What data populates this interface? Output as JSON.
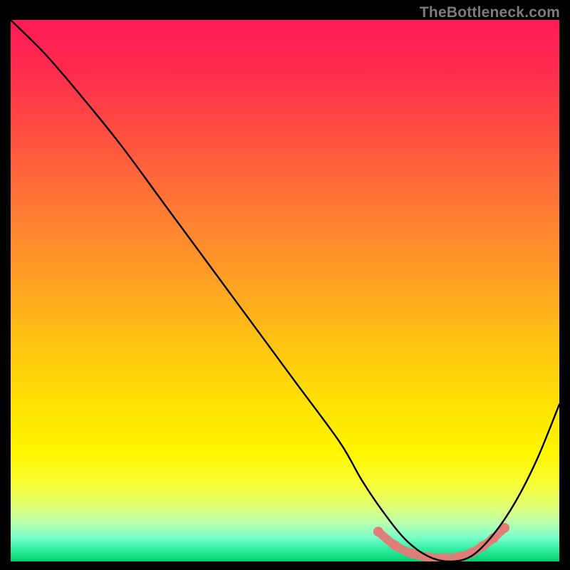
{
  "watermark": {
    "text": "TheBottleneck.com"
  },
  "chart_data": {
    "type": "line",
    "title": "",
    "xlabel": "",
    "ylabel": "",
    "xlim": [
      0,
      100
    ],
    "ylim": [
      0,
      100
    ],
    "grid": false,
    "legend": false,
    "series": [
      {
        "name": "main-curve",
        "x": [
          0,
          6,
          12,
          20,
          28,
          36,
          44,
          52,
          60,
          64,
          68,
          72,
          76,
          80,
          84,
          88,
          92,
          96,
          100
        ],
        "y": [
          100,
          94,
          87,
          77,
          66,
          55,
          44,
          33,
          22,
          15,
          9,
          4,
          1,
          0,
          1,
          5,
          11,
          19,
          29
        ]
      },
      {
        "name": "highlight-band",
        "x": [
          67,
          70,
          73,
          76,
          79,
          82,
          84,
          86,
          88,
          90
        ],
        "y": [
          5.5,
          3.0,
          1.5,
          0.8,
          0.6,
          0.9,
          1.6,
          2.8,
          4.3,
          6.2
        ]
      }
    ],
    "background_gradient_stops": [
      {
        "offset": 0.0,
        "color": "#ff1a55"
      },
      {
        "offset": 0.1,
        "color": "#ff2d4d"
      },
      {
        "offset": 0.22,
        "color": "#ff5240"
      },
      {
        "offset": 0.35,
        "color": "#ff7a34"
      },
      {
        "offset": 0.48,
        "color": "#ffa024"
      },
      {
        "offset": 0.6,
        "color": "#ffc512"
      },
      {
        "offset": 0.72,
        "color": "#ffe402"
      },
      {
        "offset": 0.8,
        "color": "#fff700"
      },
      {
        "offset": 0.86,
        "color": "#f6ff3a"
      },
      {
        "offset": 0.9,
        "color": "#e0ff78"
      },
      {
        "offset": 0.93,
        "color": "#b7ffb0"
      },
      {
        "offset": 0.955,
        "color": "#7affc8"
      },
      {
        "offset": 0.975,
        "color": "#38f0a6"
      },
      {
        "offset": 1.0,
        "color": "#00d070"
      }
    ],
    "highlight_style": {
      "stroke": "#e37b77",
      "stroke_width": 12,
      "dot_radius": 7,
      "dot_fill": "#e37b77"
    },
    "curve_style": {
      "stroke": "#000000",
      "stroke_width": 2.4
    }
  }
}
